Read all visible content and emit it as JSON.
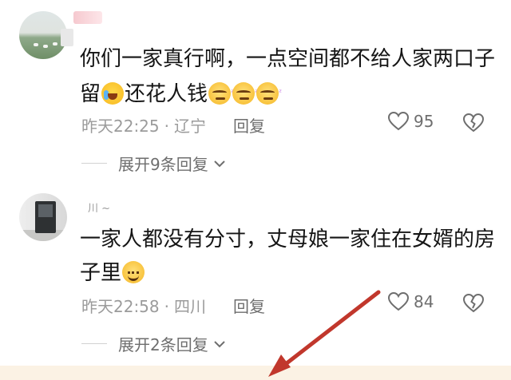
{
  "comments": [
    {
      "line1": "你们一家真行啊，一点空间都不给人家两口子",
      "line2_before": "留",
      "line2_after": "还花人钱",
      "time": "昨天22:25",
      "sep": "·",
      "location": "辽宁",
      "reply": "回复",
      "likes": "95",
      "expand": "展开9条回复"
    },
    {
      "username": "川 ~",
      "line1": "一家人都没有分寸，丈母娘一家住在女婿的房",
      "line2": "子里",
      "time": "昨天22:58",
      "sep": "·",
      "location": "四川",
      "reply": "回复",
      "likes": "84",
      "expand": "展开2条回复"
    }
  ],
  "icons": {
    "like": "heart-outline-icon",
    "dislike": "broken-heart-icon",
    "expand": "chevron-down-icon"
  },
  "colors": {
    "annotation_arrow": "#c1372c",
    "bottom_bar": "#fbf2e4"
  }
}
